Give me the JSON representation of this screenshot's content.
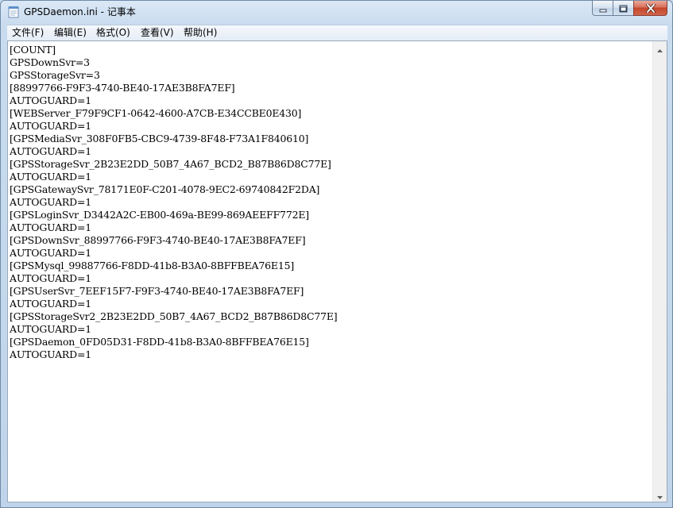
{
  "window": {
    "title": "GPSDaemon.ini - 记事本"
  },
  "icons": {
    "app": "notepad-icon",
    "minimize": "minimize-icon",
    "maximize": "maximize-icon",
    "close": "close-icon",
    "scroll_up": "arrow-up-icon",
    "scroll_down": "arrow-down-icon"
  },
  "menu": [
    {
      "label": "文件(F)"
    },
    {
      "label": "编辑(E)"
    },
    {
      "label": "格式(O)"
    },
    {
      "label": "查看(V)"
    },
    {
      "label": "帮助(H)"
    }
  ],
  "content": {
    "lines": [
      "[COUNT]",
      "GPSDownSvr=3",
      "GPSStorageSvr=3",
      "[88997766-F9F3-4740-BE40-17AE3B8FA7EF]",
      "AUTOGUARD=1",
      "[WEBServer_F79F9CF1-0642-4600-A7CB-E34CCBE0E430]",
      "AUTOGUARD=1",
      "[GPSMediaSvr_308F0FB5-CBC9-4739-8F48-F73A1F840610]",
      "AUTOGUARD=1",
      "[GPSStorageSvr_2B23E2DD_50B7_4A67_BCD2_B87B86D8C77E]",
      "AUTOGUARD=1",
      "[GPSGatewaySvr_78171E0F-C201-4078-9EC2-69740842F2DA]",
      "AUTOGUARD=1",
      "[GPSLoginSvr_D3442A2C-EB00-469a-BE99-869AEEFF772E]",
      "AUTOGUARD=1",
      "[GPSDownSvr_88997766-F9F3-4740-BE40-17AE3B8FA7EF]",
      "AUTOGUARD=1",
      "[GPSMysql_99887766-F8DD-41b8-B3A0-8BFFBEA76E15]",
      "AUTOGUARD=1",
      "[GPSUserSvr_7EEF15F7-F9F3-4740-BE40-17AE3B8FA7EF]",
      "AUTOGUARD=1",
      "[GPSStorageSvr2_2B23E2DD_50B7_4A67_BCD2_B87B86D8C77E]",
      "AUTOGUARD=1",
      "[GPSDaemon_0FD05D31-F8DD-41b8-B3A0-8BFFBEA76E15]",
      "AUTOGUARD=1"
    ]
  }
}
